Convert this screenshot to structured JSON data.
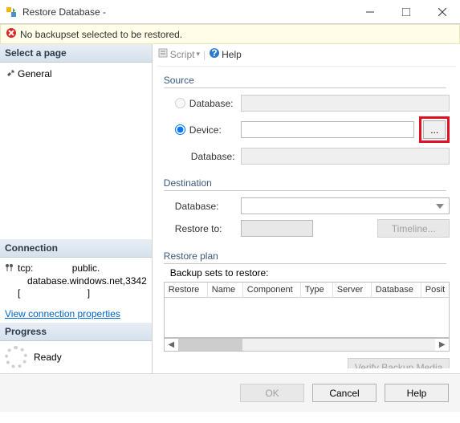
{
  "window": {
    "title": "Restore Database -"
  },
  "warning": {
    "text": "No backupset selected to be restored."
  },
  "left": {
    "select_page_header": "Select a page",
    "pages": [
      {
        "name": "General"
      }
    ],
    "connection_header": "Connection",
    "connection": {
      "protocol": "tcp:",
      "host": "public.",
      "address": "database.windows.net,3342",
      "bracket_open": "[",
      "bracket_close": "]"
    },
    "view_conn_props": "View connection properties",
    "progress_header": "Progress",
    "progress_status": "Ready"
  },
  "toolbar": {
    "script": "Script",
    "help": "Help"
  },
  "source": {
    "legend": "Source",
    "database_radio": "Database:",
    "device_radio": "Device:",
    "database_label": "Database:",
    "device_value": "",
    "ellipsis": "..."
  },
  "destination": {
    "legend": "Destination",
    "database_label": "Database:",
    "database_value": "",
    "restore_to_label": "Restore to:",
    "restore_to_value": "",
    "timeline_btn": "Timeline..."
  },
  "plan": {
    "legend": "Restore plan",
    "sets_label": "Backup sets to restore:",
    "columns": [
      "Restore",
      "Name",
      "Component",
      "Type",
      "Server",
      "Database",
      "Posit"
    ],
    "verify_btn": "Verify Backup Media"
  },
  "footer": {
    "ok": "OK",
    "cancel": "Cancel",
    "help": "Help"
  }
}
